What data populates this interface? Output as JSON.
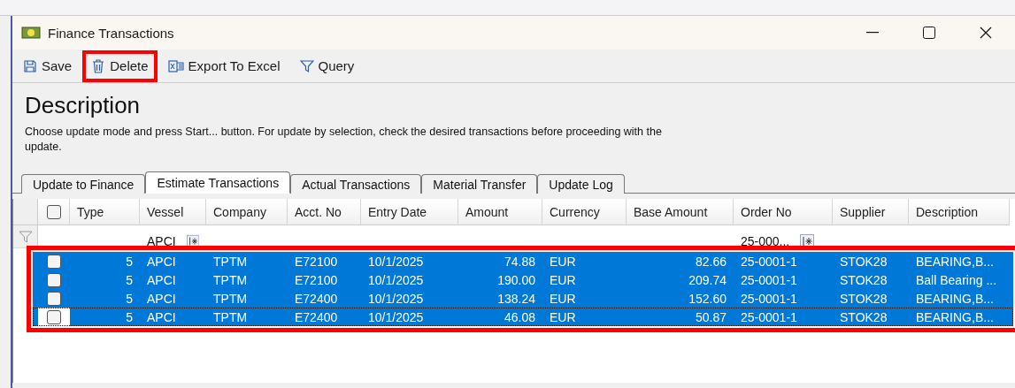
{
  "window": {
    "title": "Finance Transactions"
  },
  "toolbar": [
    {
      "label": "Save",
      "kind": "save",
      "highlighted": false
    },
    {
      "label": "Delete",
      "kind": "delete",
      "highlighted": true
    },
    {
      "label": "Export To Excel",
      "kind": "export",
      "highlighted": false
    },
    {
      "label": "Query",
      "kind": "query",
      "highlighted": false
    }
  ],
  "description": {
    "heading": "Description",
    "text": "Choose update mode and press Start... button. For update by selection, check the desired transactions before proceeding with the update."
  },
  "tabs": [
    {
      "label": "Update to Finance",
      "selected": false
    },
    {
      "label": "Estimate Transactions",
      "selected": true
    },
    {
      "label": "Actual Transactions",
      "selected": false
    },
    {
      "label": "Material Transfer",
      "selected": false
    },
    {
      "label": "Update Log",
      "selected": false
    }
  ],
  "table": {
    "header_checked": false,
    "columns": [
      {
        "label": "Type",
        "kind": "number"
      },
      {
        "label": "Vessel",
        "kind": "text",
        "filter": "APCI"
      },
      {
        "label": "Company",
        "kind": "text"
      },
      {
        "label": "Acct. No",
        "kind": "text"
      },
      {
        "label": "Entry Date",
        "kind": "text"
      },
      {
        "label": "Amount",
        "kind": "number"
      },
      {
        "label": "Currency",
        "kind": "text"
      },
      {
        "label": "Base Amount",
        "kind": "number"
      },
      {
        "label": "Order No",
        "kind": "text",
        "filter": "25-000..."
      },
      {
        "label": "Supplier",
        "kind": "text"
      },
      {
        "label": "Description",
        "kind": "text"
      }
    ],
    "rows_highlighted": true,
    "rows": [
      {
        "selected": true,
        "current": false,
        "checked": false,
        "cells": [
          "5",
          "APCI",
          "TPTM",
          "E72100",
          "10/1/2025",
          "74.88",
          "EUR",
          "82.66",
          "25-0001-1",
          "STOK28",
          "BEARING,B..."
        ]
      },
      {
        "selected": true,
        "current": false,
        "checked": false,
        "cells": [
          "5",
          "APCI",
          "TPTM",
          "E72100",
          "10/1/2025",
          "190.00",
          "EUR",
          "209.74",
          "25-0001-1",
          "STOK28",
          "Ball Bearing ..."
        ]
      },
      {
        "selected": true,
        "current": false,
        "checked": false,
        "cells": [
          "5",
          "APCI",
          "TPTM",
          "E72400",
          "10/1/2025",
          "138.24",
          "EUR",
          "152.60",
          "25-0001-1",
          "STOK28",
          "BEARING,B..."
        ]
      },
      {
        "selected": true,
        "current": true,
        "checked": false,
        "cells": [
          "5",
          "APCI",
          "TPTM",
          "E72400",
          "10/1/2025",
          "46.08",
          "EUR",
          "50.87",
          "25-0001-1",
          "STOK28",
          "BEARING,B..."
        ]
      }
    ]
  }
}
